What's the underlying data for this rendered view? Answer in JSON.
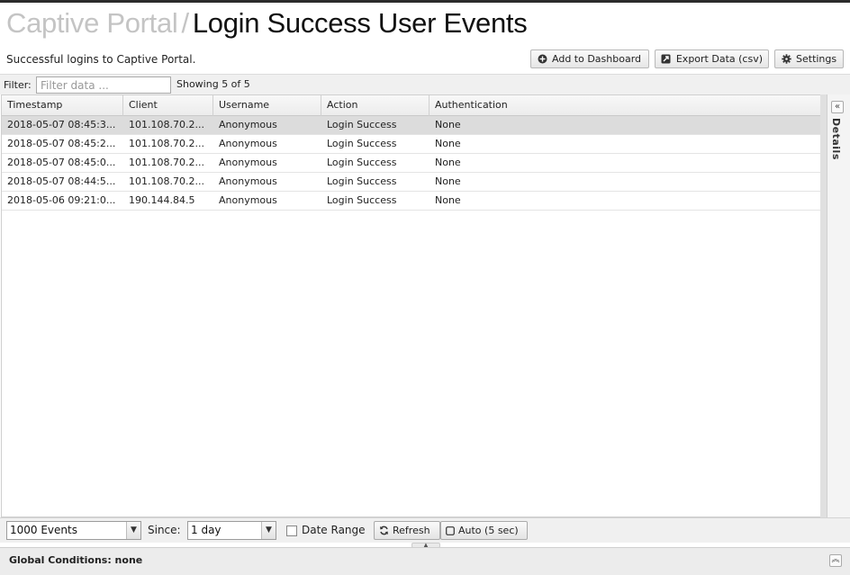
{
  "header": {
    "breadcrumb": "Captive Portal",
    "separator": "/",
    "title": "Login Success User Events",
    "subtitle": "Successful logins to Captive Portal."
  },
  "toolbar": {
    "add_dashboard": "Add to Dashboard",
    "export": "Export Data (csv)",
    "settings": "Settings"
  },
  "filter": {
    "label": "Filter:",
    "placeholder": "Filter data ...",
    "count": "Showing 5 of 5"
  },
  "grid": {
    "columns": [
      "Timestamp",
      "Client",
      "Username",
      "Action",
      "Authentication"
    ],
    "rows": [
      [
        "2018-05-07 08:45:3...",
        "101.108.70.2...",
        "Anonymous",
        "Login Success",
        "None"
      ],
      [
        "2018-05-07 08:45:2...",
        "101.108.70.2...",
        "Anonymous",
        "Login Success",
        "None"
      ],
      [
        "2018-05-07 08:45:0...",
        "101.108.70.2...",
        "Anonymous",
        "Login Success",
        "None"
      ],
      [
        "2018-05-07 08:44:5...",
        "101.108.70.2...",
        "Anonymous",
        "Login Success",
        "None"
      ],
      [
        "2018-05-06 09:21:0...",
        "190.144.84.5",
        "Anonymous",
        "Login Success",
        "None"
      ]
    ],
    "selected_row": 0
  },
  "details_pane": {
    "label": "Details",
    "collapse_icon": "double-chevron-left-icon"
  },
  "bottom": {
    "events_value": "1000 Events",
    "since_label": "Since:",
    "since_value": "1 day",
    "date_range_label": "Date Range",
    "date_range_checked": false,
    "refresh": "Refresh",
    "auto": "Auto (5 sec)"
  },
  "global": {
    "conditions": "Global Conditions: none"
  },
  "colors": {
    "selected_row": "#dcdcdc",
    "breadcrumb": "#c4c4c4"
  }
}
